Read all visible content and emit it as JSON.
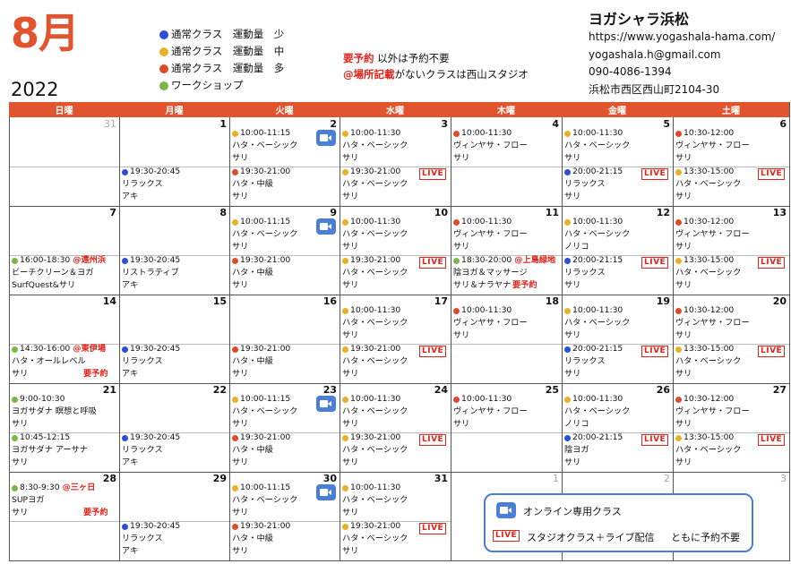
{
  "header": {
    "month": "8月",
    "year": "2022",
    "legend": [
      {
        "label": "通常クラス　運動量　少",
        "color": "#2d4fd6"
      },
      {
        "label": "通常クラス　運動量　中",
        "color": "#e9b12a"
      },
      {
        "label": "通常クラス　運動量　多",
        "color": "#dd4a2c"
      },
      {
        "label": "ワークショップ",
        "color": "#7ab648"
      }
    ],
    "notice1_red": "要予約",
    "notice1_rest": " 以外は予約不要",
    "notice2_red": "@場所記載",
    "notice2_rest": "がないクラスは西山スタジオ",
    "shop_name": "ヨガシャラ浜松",
    "url": "https://www.yogashala-hama.com/",
    "email": "yogashala.h@gmail.com",
    "phone": "090-4086-1394",
    "address": "浜松市西区西山町2104-30"
  },
  "calendar": {
    "weekdays": [
      "日曜",
      "月曜",
      "火曜",
      "水曜",
      "木曜",
      "金曜",
      "土曜"
    ],
    "days": [
      {
        "d": "31",
        "gray": true,
        "slots": []
      },
      {
        "d": "1",
        "slots": [
          {
            "half": 1,
            "c": "blue",
            "time": "19:30-20:45",
            "name": "リラックス",
            "teacher": "アキ"
          }
        ]
      },
      {
        "d": "2",
        "slots": [
          {
            "half": 0,
            "c": "yellow",
            "time": "10:00-11:15",
            "name": "ハタ・ベーシック",
            "teacher": "サリ",
            "zoom": true
          },
          {
            "half": 1,
            "c": "red",
            "time": "19:30-21:00",
            "name": "ハタ・中級",
            "teacher": "サリ"
          }
        ]
      },
      {
        "d": "3",
        "slots": [
          {
            "half": 0,
            "c": "yellow",
            "time": "10:00-11:30",
            "name": "ハタ・ベーシック",
            "teacher": "サリ"
          },
          {
            "half": 1,
            "c": "yellow",
            "time": "19:30-21:00",
            "name": "ハタ・ベーシック",
            "teacher": "サリ",
            "live": true
          }
        ]
      },
      {
        "d": "4",
        "slots": [
          {
            "half": 0,
            "c": "red",
            "time": "10:00-11:30",
            "name": "ヴィンヤサ・フロー",
            "teacher": "サリ"
          }
        ]
      },
      {
        "d": "5",
        "slots": [
          {
            "half": 0,
            "c": "yellow",
            "time": "10:00-11:30",
            "name": "ハタ・ベーシック",
            "teacher": "サリ"
          },
          {
            "half": 1,
            "c": "blue",
            "time": "20:00-21:15",
            "name": "リラックス",
            "teacher": "サリ",
            "live": true
          }
        ]
      },
      {
        "d": "6",
        "slots": [
          {
            "half": 0,
            "c": "red",
            "time": "10:30-12:00",
            "name": "ヴィンヤサ・フロー",
            "teacher": "サリ"
          },
          {
            "half": 1,
            "c": "yellow",
            "time": "13:30-15:00",
            "name": "ハタ・ベーシック",
            "teacher": "サリ",
            "live": true
          }
        ]
      },
      {
        "d": "7",
        "slots": [
          {
            "half": 1,
            "c": "green",
            "time": "16:00-18:30",
            "loc": "@遠州浜",
            "name": "ビーチクリーン＆ヨガ",
            "teacher": "SurfQuest&サリ"
          }
        ]
      },
      {
        "d": "8",
        "slots": [
          {
            "half": 1,
            "c": "blue",
            "time": "19:30-20:45",
            "name": "リストラティブ",
            "teacher": "アキ"
          }
        ]
      },
      {
        "d": "9",
        "slots": [
          {
            "half": 0,
            "c": "yellow",
            "time": "10:00-11:15",
            "name": "ハタ・ベーシック",
            "teacher": "サリ",
            "zoom": true
          },
          {
            "half": 1,
            "c": "red",
            "time": "19:30-21:00",
            "name": "ハタ・中級",
            "teacher": "サリ"
          }
        ]
      },
      {
        "d": "10",
        "slots": [
          {
            "half": 0,
            "c": "yellow",
            "time": "10:00-11:30",
            "name": "ハタ・ベーシック",
            "teacher": "サリ"
          },
          {
            "half": 1,
            "c": "yellow",
            "time": "19:30-21:00",
            "name": "ハタ・ベーシック",
            "teacher": "サリ",
            "live": true
          }
        ]
      },
      {
        "d": "11",
        "slots": [
          {
            "half": 0,
            "c": "red",
            "time": "10:00-11:30",
            "name": "ヴィンヤサ・フロー",
            "teacher": "サリ"
          },
          {
            "half": 1,
            "c": "green",
            "time": "18:30-20:00",
            "loc": "@上島緑地",
            "name": "陰ヨガ＆マッサージ",
            "teacher": "サリ＆ナラヤナ",
            "res": "要予約"
          }
        ]
      },
      {
        "d": "12",
        "slots": [
          {
            "half": 0,
            "c": "yellow",
            "time": "10:00-11:30",
            "name": "ハタ・ベーシック",
            "teacher": "ノリコ"
          },
          {
            "half": 1,
            "c": "blue",
            "time": "20:00-21:15",
            "name": "リラックス",
            "teacher": "サリ",
            "live": true
          }
        ]
      },
      {
        "d": "13",
        "slots": [
          {
            "half": 0,
            "c": "red",
            "time": "10:30-12:00",
            "name": "ヴィンヤサ・フロー",
            "teacher": "サリ"
          },
          {
            "half": 1,
            "c": "yellow",
            "time": "13:30-15:00",
            "name": "ハタ・ベーシック",
            "teacher": "サリ",
            "live": true
          }
        ]
      },
      {
        "d": "14",
        "slots": [
          {
            "half": 1,
            "c": "green",
            "time": "14:30-16:00",
            "loc": "@東伊場",
            "name": "ハタ・オールレベル",
            "teacher": "サリ",
            "res": "要予約"
          }
        ]
      },
      {
        "d": "15",
        "slots": [
          {
            "half": 1,
            "c": "blue",
            "time": "19:30-20:45",
            "name": "リラックス",
            "teacher": "アキ"
          }
        ]
      },
      {
        "d": "16",
        "slots": [
          {
            "half": 1,
            "c": "red",
            "time": "19:30-21:00",
            "name": "ハタ・中級",
            "teacher": "サリ"
          }
        ]
      },
      {
        "d": "17",
        "slots": [
          {
            "half": 0,
            "c": "yellow",
            "time": "10:00-11:30",
            "name": "ハタ・ベーシック",
            "teacher": "サリ"
          },
          {
            "half": 1,
            "c": "yellow",
            "time": "19:30-21:00",
            "name": "ハタ・ベーシック",
            "teacher": "サリ",
            "live": true
          }
        ]
      },
      {
        "d": "18",
        "slots": [
          {
            "half": 0,
            "c": "red",
            "time": "10:00-11:30",
            "name": "ヴィンヤサ・フロー",
            "teacher": "サリ"
          }
        ]
      },
      {
        "d": "19",
        "slots": [
          {
            "half": 0,
            "c": "yellow",
            "time": "10:00-11:30",
            "name": "ハタ・ベーシック",
            "teacher": "サリ"
          },
          {
            "half": 1,
            "c": "blue",
            "time": "20:00-21:15",
            "name": "リラックス",
            "teacher": "サリ",
            "live": true
          }
        ]
      },
      {
        "d": "20",
        "slots": [
          {
            "half": 0,
            "c": "red",
            "time": "10:30-12:00",
            "name": "ヴィンヤサ・フロー",
            "teacher": "サリ"
          },
          {
            "half": 1,
            "c": "yellow",
            "time": "13:30-15:00",
            "name": "ハタ・ベーシック",
            "teacher": "サリ",
            "live": true
          }
        ]
      },
      {
        "d": "21",
        "slots": [
          {
            "half": 0,
            "c": "green",
            "time": "9:00-10:30",
            "name": "ヨガサダナ 瞑想と呼吸",
            "teacher": "サリ"
          },
          {
            "half": 1,
            "c": "green",
            "time": "10:45-12:15",
            "name": "ヨガサダナ アーサナ",
            "teacher": "サリ"
          }
        ]
      },
      {
        "d": "22",
        "slots": [
          {
            "half": 1,
            "c": "blue",
            "time": "19:30-20:45",
            "name": "リラックス",
            "teacher": "アキ"
          }
        ]
      },
      {
        "d": "23",
        "slots": [
          {
            "half": 0,
            "c": "yellow",
            "time": "10:00-11:15",
            "name": "ハタ・ベーシック",
            "teacher": "サリ",
            "zoom": true
          },
          {
            "half": 1,
            "c": "red",
            "time": "19:30-21:00",
            "name": "ハタ・中級",
            "teacher": "サリ"
          }
        ]
      },
      {
        "d": "24",
        "slots": [
          {
            "half": 0,
            "c": "yellow",
            "time": "10:00-11:30",
            "name": "ハタ・ベーシック",
            "teacher": "サリ"
          },
          {
            "half": 1,
            "c": "yellow",
            "time": "19:30-21:00",
            "name": "ハタ・ベーシック",
            "teacher": "サリ",
            "live": true
          }
        ]
      },
      {
        "d": "25",
        "slots": [
          {
            "half": 0,
            "c": "red",
            "time": "10:00-11:30",
            "name": "ヴィンヤサ・フロー",
            "teacher": "サリ"
          }
        ]
      },
      {
        "d": "26",
        "slots": [
          {
            "half": 0,
            "c": "yellow",
            "time": "10:00-11:30",
            "name": "ハタ・ベーシック",
            "teacher": "ノリコ"
          },
          {
            "half": 1,
            "c": "blue",
            "time": "20:00-21:15",
            "name": "陰ヨガ",
            "teacher": "サリ",
            "live": true
          }
        ]
      },
      {
        "d": "27",
        "slots": [
          {
            "half": 0,
            "c": "red",
            "time": "10:30-12:00",
            "name": "ヴィンヤサ・フロー",
            "teacher": "サリ"
          },
          {
            "half": 1,
            "c": "yellow",
            "time": "13:30-15:00",
            "name": "ハタ・ベーシック",
            "teacher": "サリ",
            "live": true
          }
        ]
      },
      {
        "d": "28",
        "slots": [
          {
            "half": 0,
            "c": "green",
            "time": "8:30-9:30",
            "loc": "@三ヶ日",
            "name": "SUPヨガ",
            "teacher": "サリ",
            "res": "要予約"
          }
        ]
      },
      {
        "d": "29",
        "slots": [
          {
            "half": 1,
            "c": "blue",
            "time": "19:30-20:45",
            "name": "リラックス",
            "teacher": "アキ"
          }
        ]
      },
      {
        "d": "30",
        "slots": [
          {
            "half": 0,
            "c": "yellow",
            "time": "10:00-11:15",
            "name": "ハタ・ベーシック",
            "teacher": "サリ",
            "zoom": true
          },
          {
            "half": 1,
            "c": "red",
            "time": "19:30-21:00",
            "name": "ハタ・中級",
            "teacher": "サリ"
          }
        ]
      },
      {
        "d": "31",
        "slots": [
          {
            "half": 0,
            "c": "yellow",
            "time": "10:00-11:30",
            "name": "ハタ・ベーシック",
            "teacher": "サリ"
          },
          {
            "half": 1,
            "c": "yellow",
            "time": "19:30-21:00",
            "name": "ハタ・ベーシック",
            "teacher": "サリ",
            "live": true
          }
        ]
      },
      {
        "d": "1",
        "gray": true,
        "slots": []
      },
      {
        "d": "2",
        "gray": true,
        "slots": []
      },
      {
        "d": "3",
        "gray": true,
        "slots": []
      }
    ],
    "live_label": "LIVE",
    "colors": {
      "blue": "#2d4fd6",
      "yellow": "#e9b12a",
      "red": "#dd4a2c",
      "green": "#7ab648",
      "accent": "#e2542e",
      "live": "#e2231a",
      "zoom": "#4a7fd8"
    }
  },
  "footer_legend": {
    "online_label": "オンライン専用クラス",
    "live_badge": "LIVE",
    "live_label": "スタジオクラス＋ライブ配信",
    "live_note": "ともに予約不要"
  }
}
